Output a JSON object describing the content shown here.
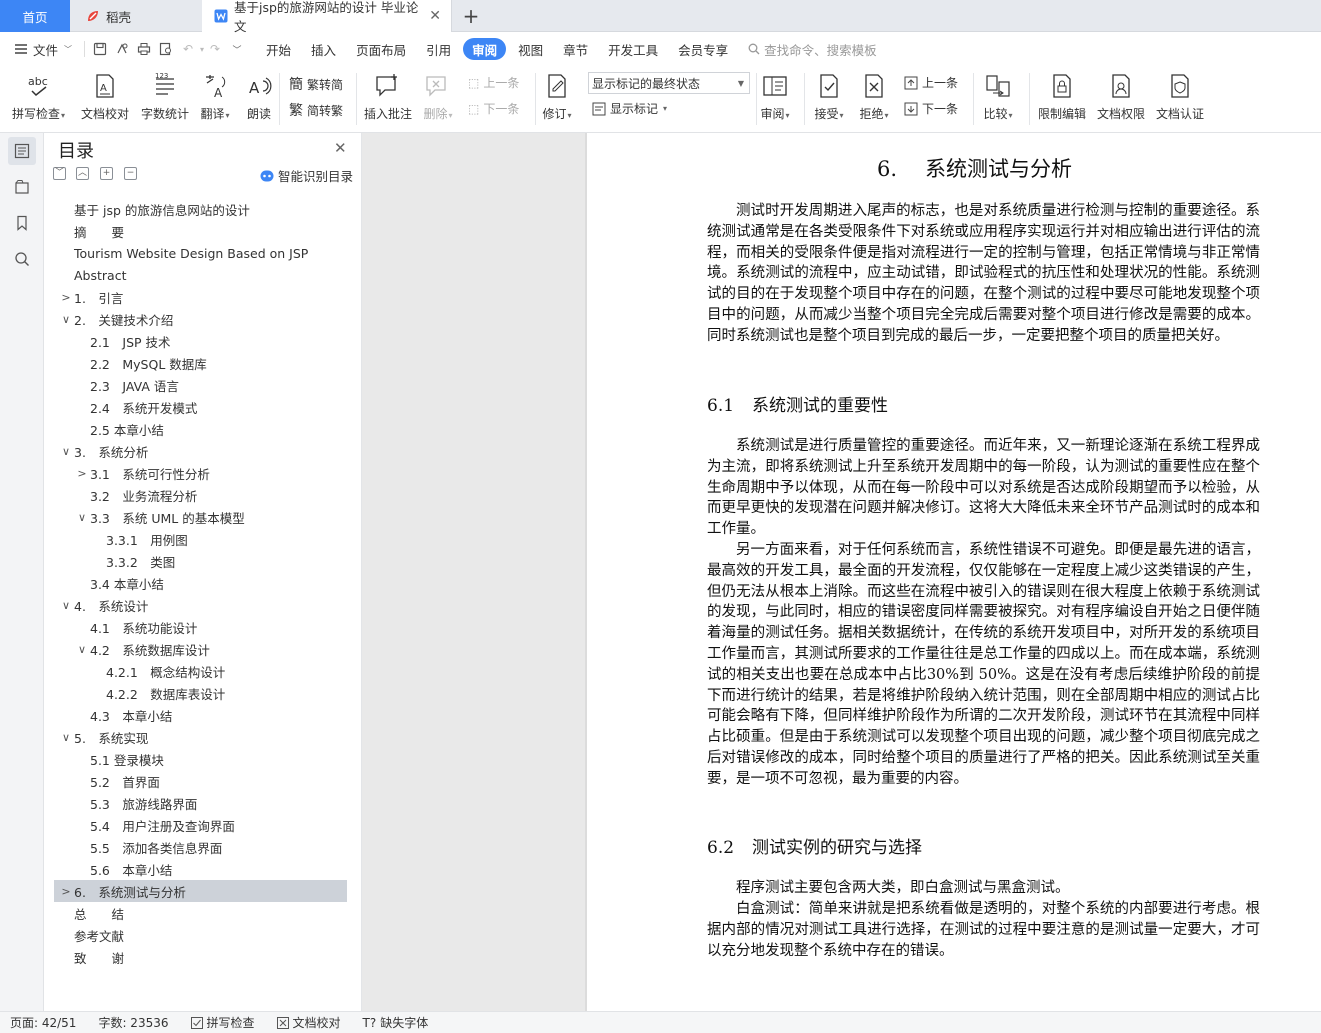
{
  "tabs": {
    "home": "首页",
    "daoke": "稻壳",
    "doc": "基于jsp的旅游网站的设计 毕业论文",
    "add": "+"
  },
  "menu": {
    "file": "文件",
    "items": [
      "开始",
      "插入",
      "页面布局",
      "引用",
      "审阅",
      "视图",
      "章节",
      "开发工具",
      "会员专享"
    ],
    "active": "审阅",
    "search": "查找命令、搜索模板"
  },
  "ribbon": {
    "spellcheck": "拼写检查",
    "doc_proof": "文档校对",
    "word_count": "字数统计",
    "translate": "翻译",
    "read_aloud": "朗读",
    "to_traditional": "繁转简",
    "to_simplified": "简转繁",
    "insert_comment": "插入批注",
    "delete": "删除",
    "prev_comment": "上一条",
    "next_comment": "下一条",
    "track_changes": "修订",
    "track_select": "显示标记的最终状态",
    "show_markup": "显示标记",
    "review": "审阅",
    "accept": "接受",
    "reject": "拒绝",
    "prev_change": "上一条",
    "next_change": "下一条",
    "compare": "比较",
    "restrict_edit": "限制编辑",
    "doc_permission": "文档权限",
    "doc_certify": "文档认证"
  },
  "toc": {
    "title": "目录",
    "smart": "智能识别目录",
    "items": [
      {
        "level": 0,
        "arrow": "",
        "text": "基于 jsp 的旅游信息网站的设计",
        "selected": false
      },
      {
        "level": 0,
        "arrow": "",
        "text": "摘　　要",
        "selected": false
      },
      {
        "level": 0,
        "arrow": "",
        "text": "Tourism Website Design Based on JSP",
        "selected": false
      },
      {
        "level": 0,
        "arrow": "",
        "text": "Abstract",
        "selected": false
      },
      {
        "level": 0,
        "arrow": "right",
        "text": "1.　引言",
        "selected": false
      },
      {
        "level": 0,
        "arrow": "down",
        "text": "2.　关键技术介绍",
        "selected": false
      },
      {
        "level": 1,
        "arrow": "",
        "text": "2.1　JSP 技术",
        "selected": false
      },
      {
        "level": 1,
        "arrow": "",
        "text": "2.2　MySQL 数据库",
        "selected": false
      },
      {
        "level": 1,
        "arrow": "",
        "text": "2.3　JAVA 语言",
        "selected": false
      },
      {
        "level": 1,
        "arrow": "",
        "text": "2.4　系统开发模式",
        "selected": false
      },
      {
        "level": 1,
        "arrow": "",
        "text": "2.5 本章小结",
        "selected": false
      },
      {
        "level": 0,
        "arrow": "down",
        "text": "3.　系统分析",
        "selected": false
      },
      {
        "level": 1,
        "arrow": "right",
        "text": "3.1　系统可行性分析",
        "selected": false
      },
      {
        "level": 1,
        "arrow": "",
        "text": "3.2　业务流程分析",
        "selected": false
      },
      {
        "level": 1,
        "arrow": "down",
        "text": "3.3　系统 UML 的基本模型",
        "selected": false
      },
      {
        "level": 2,
        "arrow": "",
        "text": "3.3.1　用例图",
        "selected": false
      },
      {
        "level": 2,
        "arrow": "",
        "text": "3.3.2　类图",
        "selected": false
      },
      {
        "level": 1,
        "arrow": "",
        "text": "3.4 本章小结",
        "selected": false
      },
      {
        "level": 0,
        "arrow": "down",
        "text": "4.　系统设计",
        "selected": false
      },
      {
        "level": 1,
        "arrow": "",
        "text": "4.1　系统功能设计",
        "selected": false
      },
      {
        "level": 1,
        "arrow": "down",
        "text": "4.2　系统数据库设计",
        "selected": false
      },
      {
        "level": 2,
        "arrow": "",
        "text": "4.2.1　概念结构设计",
        "selected": false
      },
      {
        "level": 2,
        "arrow": "",
        "text": "4.2.2　数据库表设计",
        "selected": false
      },
      {
        "level": 1,
        "arrow": "",
        "text": "4.3　本章小结",
        "selected": false
      },
      {
        "level": 0,
        "arrow": "down",
        "text": "5.　系统实现",
        "selected": false
      },
      {
        "level": 1,
        "arrow": "",
        "text": "5.1 登录模块",
        "selected": false
      },
      {
        "level": 1,
        "arrow": "",
        "text": "5.2　首界面",
        "selected": false
      },
      {
        "level": 1,
        "arrow": "",
        "text": "5.3　旅游线路界面",
        "selected": false
      },
      {
        "level": 1,
        "arrow": "",
        "text": "5.4　用户注册及查询界面",
        "selected": false
      },
      {
        "level": 1,
        "arrow": "",
        "text": "5.5　添加各类信息界面",
        "selected": false
      },
      {
        "level": 1,
        "arrow": "",
        "text": "5.6　本章小结",
        "selected": false
      },
      {
        "level": 0,
        "arrow": "right",
        "text": "6.　系统测试与分析",
        "selected": true
      },
      {
        "level": 0,
        "arrow": "",
        "text": "总　　结",
        "selected": false
      },
      {
        "level": 0,
        "arrow": "",
        "text": "参考文献",
        "selected": false
      },
      {
        "level": 0,
        "arrow": "",
        "text": "致　　谢",
        "selected": false
      }
    ]
  },
  "document": {
    "chapter_num": "6.",
    "chapter_title": "系统测试与分析",
    "p1": "测试时开发周期进入尾声的标志，也是对系统质量进行检测与控制的重要途径。系统测试通常是在各类受限条件下对系统或应用程序实现运行并对相应输出进行评估的流程，而相关的受限条件便是指对流程进行一定的控制与管理，包括正常情境与非正常情境。系统测试的流程中，应主动试错，即试验程式的抗压性和处理状况的性能。系统测试的目的在于发现整个项目中存在的问题，在整个测试的过程中要尽可能地发现整个项目中的问题，从而减少当整个项目完全完成后需要对整个项目进行修改是需要的成本。同时系统测试也是整个项目到完成的最后一步，一定要把整个项目的质量把关好。",
    "s1_num": "6.1",
    "s1_title": "系统测试的重要性",
    "p2": "系统测试是进行质量管控的重要途径。而近年来，又一新理论逐渐在系统工程界成为主流，即将系统测试上升至系统开发周期中的每一阶段，认为测试的重要性应在整个生命周期中予以体现，从而在每一阶段中可以对系统是否达成阶段期望而予以检验，从而更早更快的发现潜在问题并解决修订。这将大大降低未来全环节产品测试时的成本和工作量。",
    "p3": "另一方面来看，对于任何系统而言，系统性错误不可避免。即便是最先进的语言，最高效的开发工具，最全面的开发流程，仅仅能够在一定程度上减少这类错误的产生，但仍无法从根本上消除。而这些在流程中被引入的错误则在很大程度上依赖于系统测试的发现，与此同时，相应的错误密度同样需要被探究。对有程序编设自开始之日便伴随着海量的测试任务。据相关数据统计，在传统的系统开发项目中，对所开发的系统项目工作量而言，其测试所要求的工作量往往是总工作量的四成以上。而在成本端，系统测试的相关支出也要在总成本中占比30%到 50%。这是在没有考虑后续维护阶段的前提下而进行统计的结果，若是将维护阶段纳入统计范围，则在全部周期中相应的测试占比可能会略有下降，但同样维护阶段作为所谓的二次开发阶段，测试环节在其流程中同样占比硕重。但是由于系统测试可以发现整个项目出现的问题，减少整个项目彻底完成之后对错误修改的成本，同时给整个项目的质量进行了严格的把关。因此系统测试至关重要，是一项不可忽视，最为重要的内容。",
    "s2_num": "6.2",
    "s2_title": "测试实例的研究与选择",
    "p4": "程序测试主要包含两大类，即白盒测试与黑盒测试。",
    "p5": "白盒测试：简单来讲就是把系统看做是透明的，对整个系统的内部要进行考虑。根据内部的情况对测试工具进行选择，在测试的过程中要注意的是测试量一定要大，才可以充分地发现整个系统中存在的错误。"
  },
  "status": {
    "page": "页面: 42/51",
    "words": "字数: 23536",
    "spell": "拼写检查",
    "proof": "文档校对",
    "missing_font": "缺失字体"
  },
  "colors": {
    "accent": "#3d86f5",
    "selected_row": "#cdd2d9",
    "wps_red": "#e8453c"
  }
}
